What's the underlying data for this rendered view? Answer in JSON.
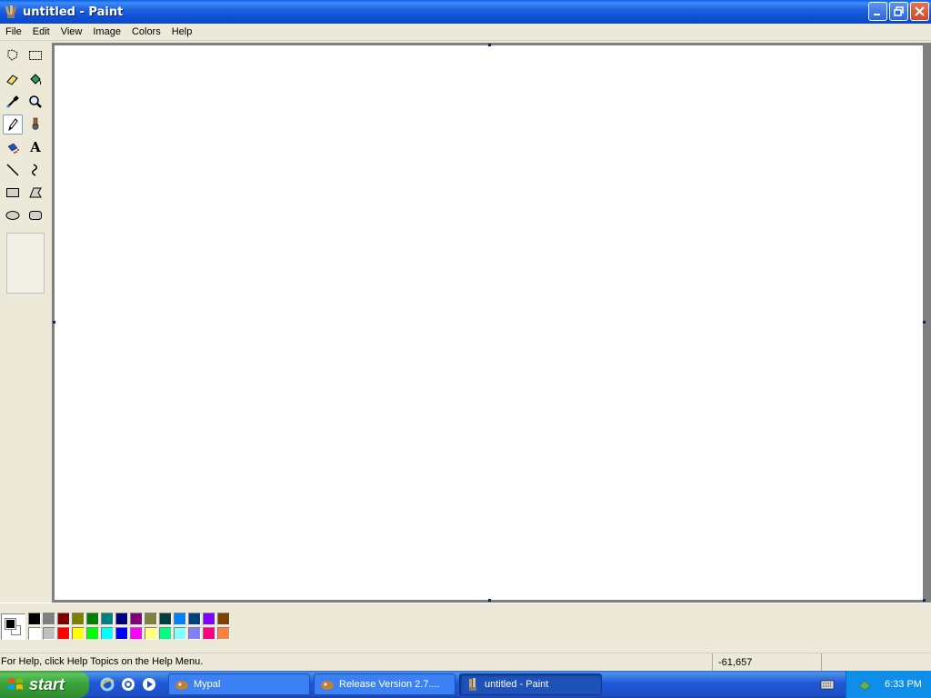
{
  "window": {
    "title": "untitled - Paint"
  },
  "menu": [
    "File",
    "Edit",
    "View",
    "Image",
    "Colors",
    "Help"
  ],
  "tools": [
    {
      "name": "free-form-select"
    },
    {
      "name": "select"
    },
    {
      "name": "eraser"
    },
    {
      "name": "fill-with-color"
    },
    {
      "name": "pick-color"
    },
    {
      "name": "magnifier"
    },
    {
      "name": "pencil",
      "selected": true
    },
    {
      "name": "brush"
    },
    {
      "name": "airbrush"
    },
    {
      "name": "text"
    },
    {
      "name": "line"
    },
    {
      "name": "curve"
    },
    {
      "name": "rectangle"
    },
    {
      "name": "polygon"
    },
    {
      "name": "ellipse"
    },
    {
      "name": "rounded-rectangle"
    }
  ],
  "text_tool_glyph": "A",
  "palette": {
    "foreground": "#000000",
    "background": "#ffffff",
    "row1": [
      "#000000",
      "#808080",
      "#800000",
      "#808000",
      "#008000",
      "#008080",
      "#000080",
      "#800080",
      "#808040",
      "#004040",
      "#0080ff",
      "#004080",
      "#8000ff",
      "#804000"
    ],
    "row2": [
      "#ffffff",
      "#c0c0c0",
      "#ff0000",
      "#ffff00",
      "#00ff00",
      "#00ffff",
      "#0000ff",
      "#ff00ff",
      "#ffff80",
      "#00ff80",
      "#80ffff",
      "#8080ff",
      "#ff0080",
      "#ff8040"
    ]
  },
  "status": {
    "help_text": "For Help, click Help Topics on the Help Menu.",
    "coords": "-61,657"
  },
  "taskbar": {
    "start_label": "start",
    "tasks": [
      {
        "label": "Mypal",
        "active": false
      },
      {
        "label": "Release Version 2.7....",
        "active": false
      },
      {
        "label": "untitled - Paint",
        "active": true
      }
    ],
    "clock": "6:33 PM"
  }
}
